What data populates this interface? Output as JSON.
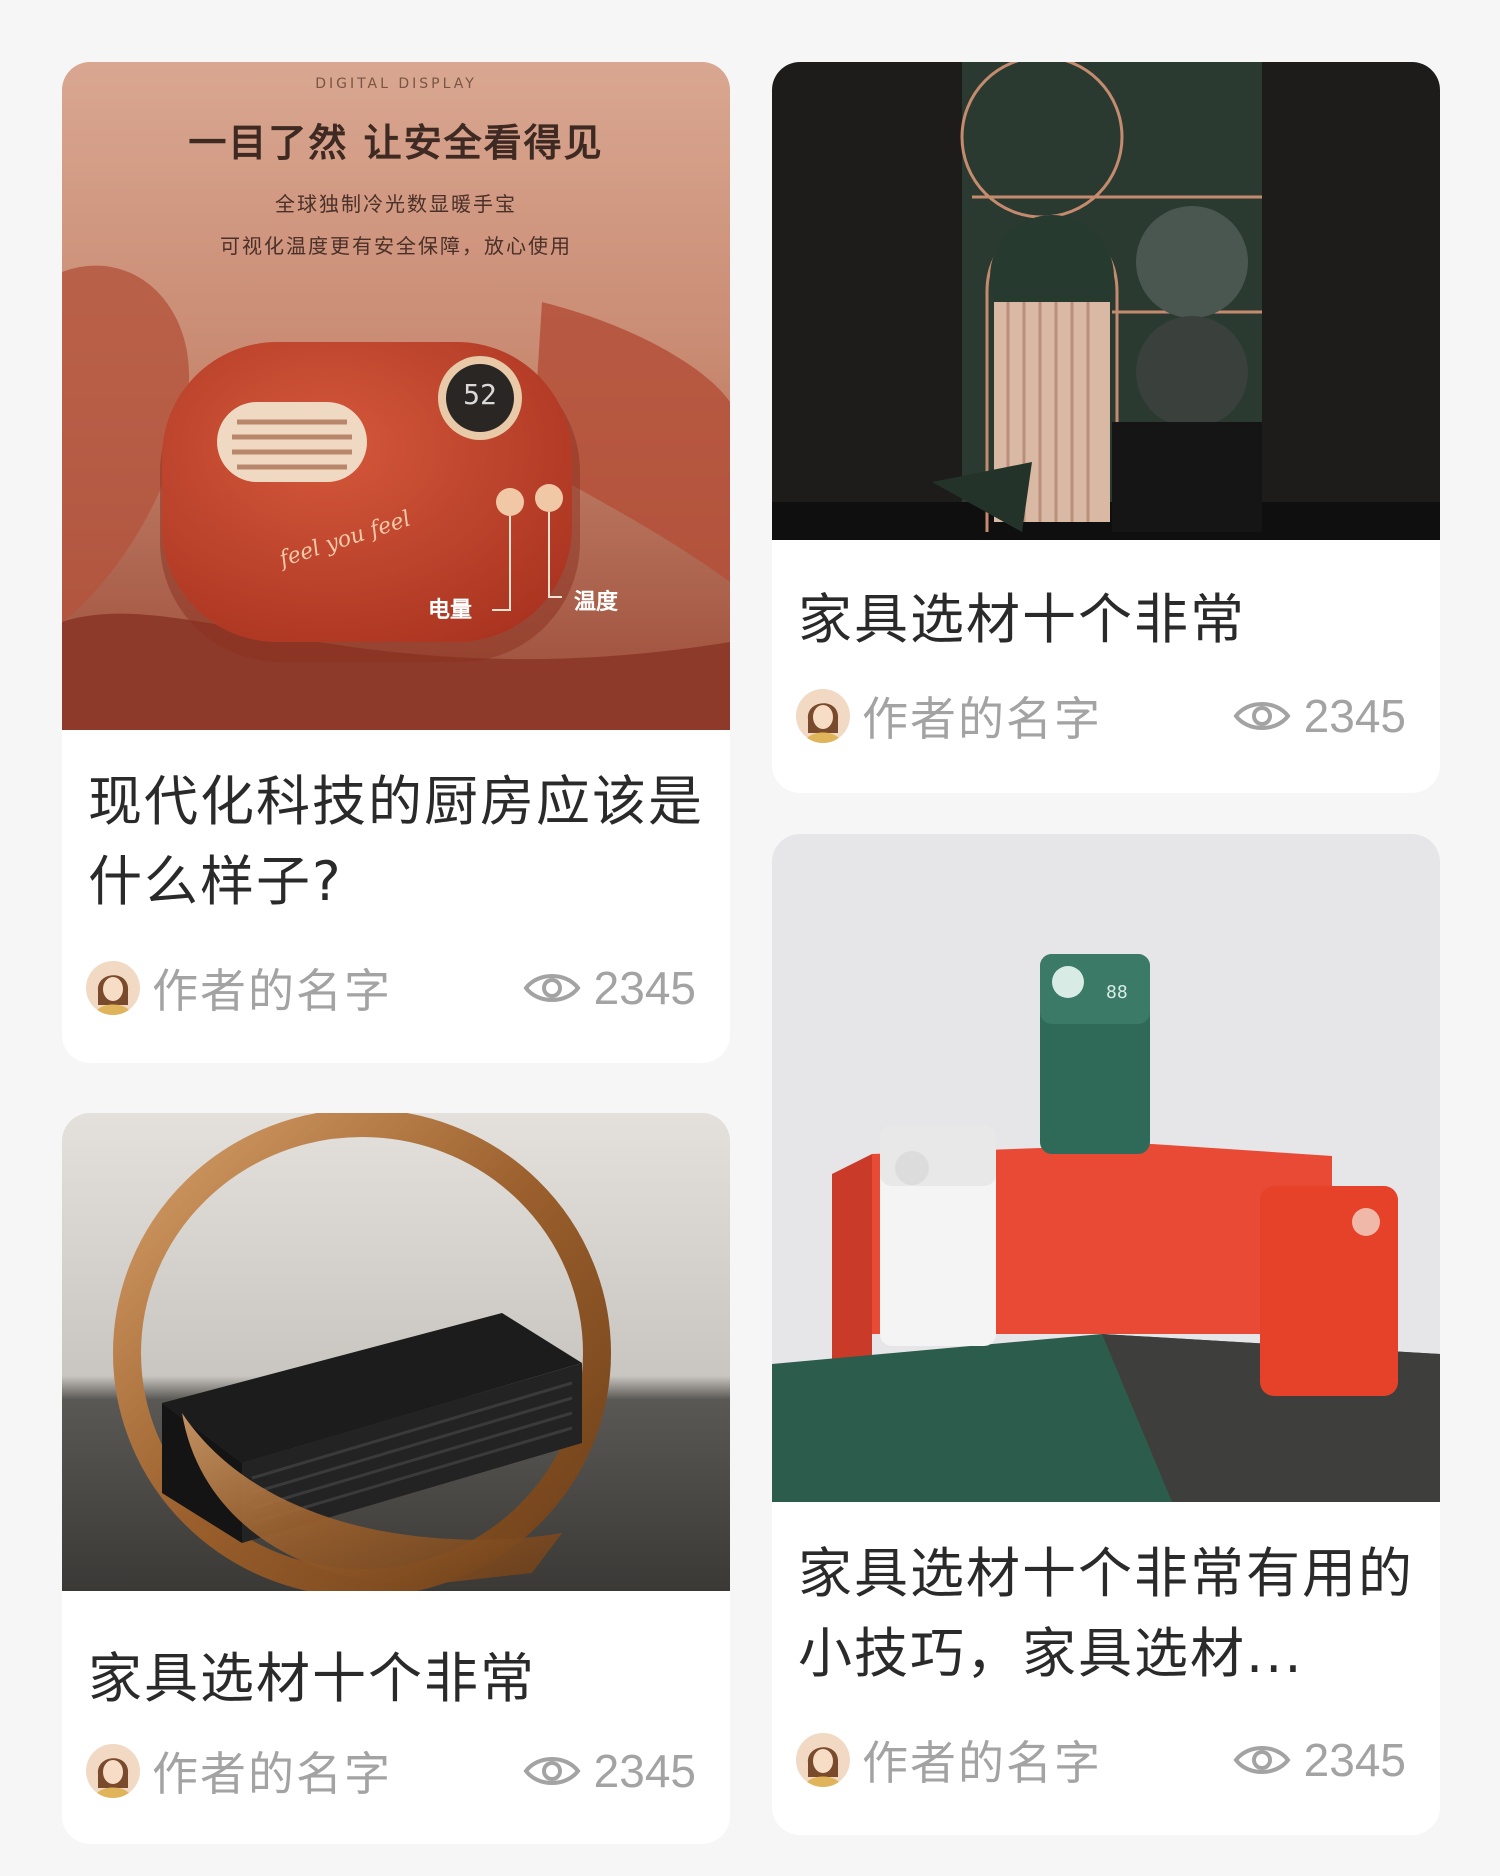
{
  "cards": [
    {
      "title": "现代化科技的厨房应该是什么样子?",
      "author": "作者的名字",
      "views": "2345",
      "image": {
        "kicker": "DIGITAL DISPLAY",
        "headline": "一目了然 让安全看得见",
        "line1": "全球独制冷光数显暖手宝",
        "line2": "可视化温度更有安全保障，放心使用",
        "display": "52",
        "script": "feel you feel",
        "label_power": "电量",
        "label_temp": "温度"
      }
    },
    {
      "title": "家具选材十个非常",
      "author": "作者的名字",
      "views": "2345"
    },
    {
      "title": "家具选材十个非常",
      "author": "作者的名字",
      "views": "2345"
    },
    {
      "title": "家具选材十个非常有用的小技巧，家具选材...",
      "author": "作者的名字",
      "views": "2345",
      "image": {
        "display": "88"
      }
    }
  ],
  "icons": {
    "views": "eye-icon",
    "avatar": "avatar-illustration"
  },
  "colors": {
    "background": "#f6f6f7",
    "card": "#ffffff",
    "title": "#2a2a2a",
    "meta": "#a3a3a3"
  }
}
